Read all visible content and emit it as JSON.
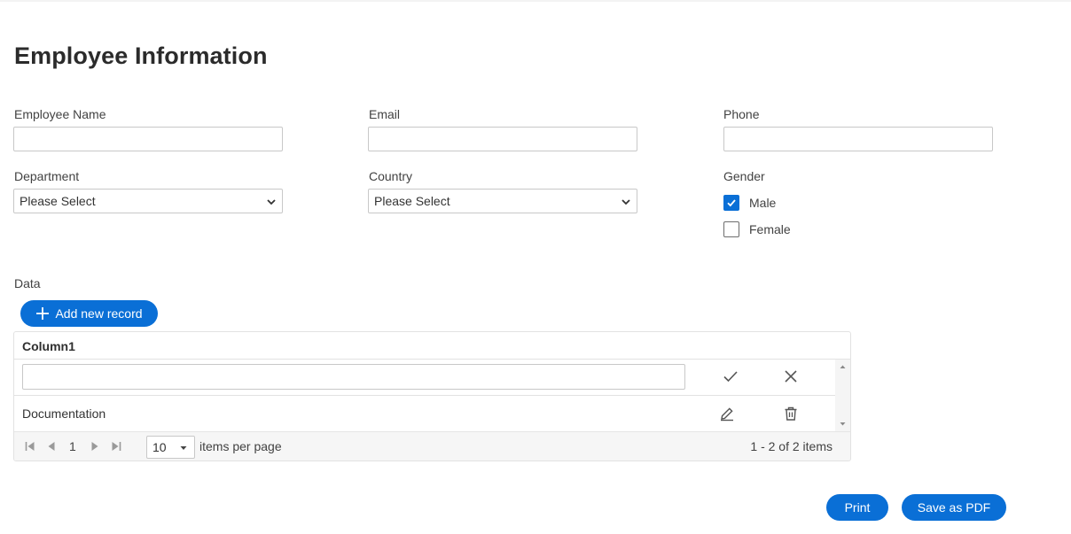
{
  "page": {
    "title": "Employee Information"
  },
  "form": {
    "employee_name": {
      "label": "Employee Name",
      "value": ""
    },
    "email": {
      "label": "Email",
      "value": ""
    },
    "phone": {
      "label": "Phone",
      "value": ""
    },
    "department": {
      "label": "Department",
      "selected": "Please Select"
    },
    "country": {
      "label": "Country",
      "selected": "Please Select"
    },
    "gender": {
      "label": "Gender",
      "options": [
        {
          "label": "Male",
          "checked": true
        },
        {
          "label": "Female",
          "checked": false
        }
      ]
    }
  },
  "data_section": {
    "label": "Data",
    "add_button": "Add new record",
    "column_header": "Column1",
    "edit_row_value": "",
    "rows": [
      {
        "value": "Documentation"
      }
    ],
    "pager": {
      "current_page": "1",
      "page_size": "10",
      "items_per_page_label": "items per page",
      "summary": "1 - 2 of 2 items"
    }
  },
  "actions": {
    "print": "Print",
    "save_pdf": "Save as PDF"
  },
  "colors": {
    "accent": "#0a6fd6"
  },
  "icons": [
    "plus-icon",
    "check-icon",
    "close-icon",
    "edit-icon",
    "trash-icon",
    "first-page-icon",
    "prev-page-icon",
    "next-page-icon",
    "last-page-icon",
    "chevron-down-icon"
  ]
}
